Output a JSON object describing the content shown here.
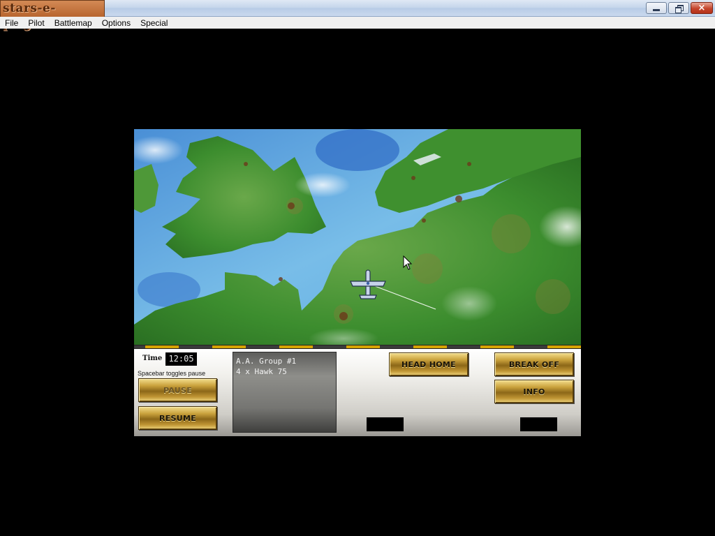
{
  "window": {
    "app_logo": "stars-e-prig.net",
    "controls": {
      "minimize": "minimize",
      "maximize": "restore",
      "close": "×"
    }
  },
  "menu": [
    "File",
    "Pilot",
    "Battlemap",
    "Options",
    "Special"
  ],
  "panel": {
    "time_label": "Time",
    "time_value": "12:05",
    "hint": "Spacebar toggles pause",
    "buttons": {
      "pause": "PAUSE",
      "resume": "RESUME",
      "head_home": "HEAD HOME",
      "break_off": "BREAK OFF",
      "info": "INFO"
    },
    "info_lines": [
      "A.A. Group #1",
      "4 x Hawk 75"
    ]
  },
  "colors": {
    "sea": "#5aa8e0",
    "land": "#3a8f2a",
    "gold": "#caa23d",
    "hazard_yellow": "#d6a400"
  },
  "icons": [
    "aircraft-icon",
    "mouse-cursor-icon"
  ]
}
